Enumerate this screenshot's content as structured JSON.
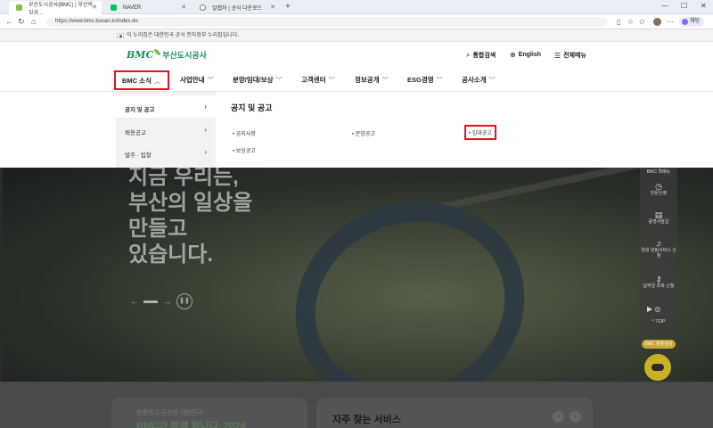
{
  "browser": {
    "tabs": [
      {
        "label": "부산도시공사(BMC) | 부산의 일상...",
        "active": true
      },
      {
        "label": "NAVER",
        "active": false
      },
      {
        "label": "알캡처 | 공식 다운로드",
        "active": false
      }
    ],
    "url": "https://www.bmc.busan.kr/index.do",
    "profile_label": "채팅"
  },
  "notice": {
    "text": "이 누리집은 대한민국 공식 전자정부 누리집입니다."
  },
  "header": {
    "logo_bmc": "BMC",
    "logo_name": "부산도시공사",
    "utils": [
      {
        "label": "통합검색",
        "icon": "search-icon"
      },
      {
        "label": "English",
        "icon": "globe-icon"
      },
      {
        "label": "전체메뉴",
        "icon": "menu-icon"
      }
    ]
  },
  "gnb": {
    "items": [
      "BMC 소식",
      "사업안내",
      "분양/임대/보상",
      "고객센터",
      "정보공개",
      "ESG경영",
      "공사소개"
    ]
  },
  "dropdown": {
    "lnb": [
      "공지 및 공고",
      "채용공고",
      "발주 · 입찰"
    ],
    "title": "공지 및 공고",
    "links": [
      "공지사항",
      "분양공고",
      "임대공고",
      "보상공고"
    ]
  },
  "hero": {
    "headline": "지금 우리는,\n부산의 일상을\n만들고\n있습니다."
  },
  "quick": {
    "head": "BMC 퀵메뉴",
    "items": [
      "민원신청",
      "증명서발급",
      "임대 알림서비스 신청",
      "납부금 조회·신청"
    ],
    "top": "TOP",
    "badge": "BMC 챗봇상담"
  },
  "lower": {
    "card_left_sub": "청렴하고 공정한 대한민국",
    "card_left_title": "BMC가 함께 합니다. 2024",
    "card_right_title": "자주 찾는 서비스"
  },
  "colors": {
    "brand_green": "#1b8f55",
    "highlight_red": "#e3141b"
  }
}
